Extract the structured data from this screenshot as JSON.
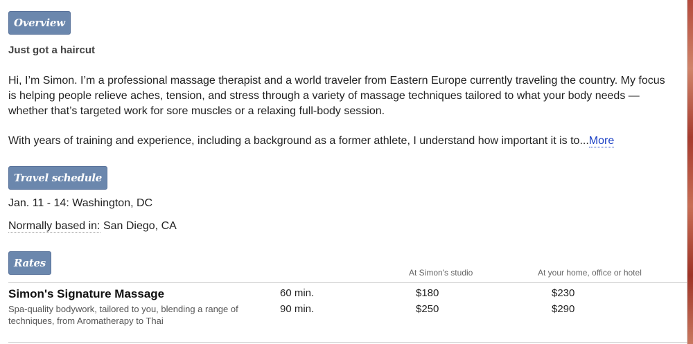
{
  "sections": {
    "overview": "Overview",
    "travel": "Travel schedule",
    "rates": "Rates"
  },
  "overview": {
    "headline": "Just got a haircut",
    "paragraph1": "Hi, I’m Simon. I’m a professional massage therapist and a world traveler from Eastern Europe currently traveling the country. My focus is helping people relieve aches, tension, and stress through a variety of massage techniques tailored to what your body needs — whether that’s targeted work for sore muscles or a relaxing full-body session.",
    "paragraph2": "With years of training and experience, including a background as a former athlete, I understand how important it is to...",
    "more_label": "More"
  },
  "travel": {
    "entry1": "Jan. 11 - 14: Washington, DC",
    "based_label": "Normally based in:",
    "based_value": "San Diego, CA"
  },
  "rates": {
    "col_studio": "At Simon's studio",
    "col_home": "At your home, office or hotel",
    "service": {
      "name": "Simon's Signature Massage",
      "description": "Spa-quality bodywork, tailored to you, blending a range of techniques, from Aromatherapy to Thai",
      "rows": [
        {
          "duration": "60 min.",
          "studio": "$180",
          "home": "$230"
        },
        {
          "duration": "90 min.",
          "studio": "$250",
          "home": "$290"
        }
      ]
    }
  }
}
